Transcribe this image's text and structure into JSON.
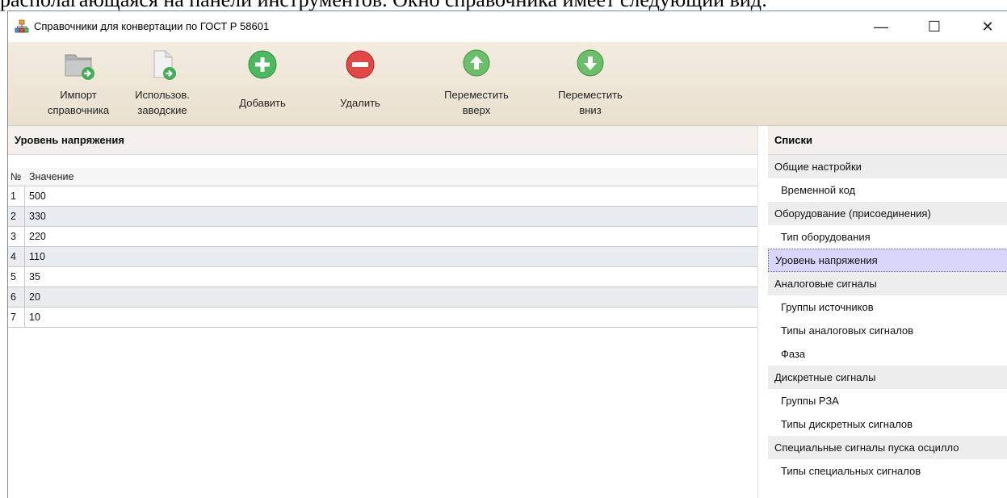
{
  "doc_text": "располагающаяся на панели инструментов. Окно справочника имеет следующий вид:",
  "window": {
    "title": "Справочники для конвертации по ГОСТ Р 58601",
    "minimize": "—",
    "maximize": "☐",
    "close": "✕"
  },
  "toolbar": {
    "import": {
      "line1": "Импорт",
      "line2": "справочника"
    },
    "use_factory": {
      "line1": "Использов.",
      "line2": "заводские"
    },
    "add": {
      "line1": "Добавить"
    },
    "delete": {
      "line1": "Удалить"
    },
    "move_up": {
      "line1": "Переместить",
      "line2": "вверх"
    },
    "move_down": {
      "line1": "Переместить",
      "line2": "вниз"
    }
  },
  "left_panel": {
    "title": "Уровень напряжения",
    "columns": {
      "no": "№",
      "value": "Значение"
    },
    "rows": [
      {
        "no": "1",
        "value": "500"
      },
      {
        "no": "2",
        "value": "330"
      },
      {
        "no": "3",
        "value": "220"
      },
      {
        "no": "4",
        "value": "110"
      },
      {
        "no": "5",
        "value": "35"
      },
      {
        "no": "6",
        "value": "20"
      },
      {
        "no": "7",
        "value": "10"
      }
    ]
  },
  "right_panel": {
    "title": "Списки",
    "items": [
      {
        "label": "Общие настройки",
        "type": "group"
      },
      {
        "label": "Временной код",
        "type": "child"
      },
      {
        "label": "Оборудование (присоединения)",
        "type": "group"
      },
      {
        "label": "Тип оборудования",
        "type": "child"
      },
      {
        "label": "Уровень напряжения",
        "type": "selected"
      },
      {
        "label": "Аналоговые сигналы",
        "type": "group"
      },
      {
        "label": "Группы источников",
        "type": "child"
      },
      {
        "label": "Типы аналоговых сигналов",
        "type": "child"
      },
      {
        "label": "Фаза",
        "type": "child"
      },
      {
        "label": "Дискретные сигналы",
        "type": "group"
      },
      {
        "label": "Группы РЗА",
        "type": "child"
      },
      {
        "label": "Типы дискретных сигналов",
        "type": "child"
      },
      {
        "label": "Специальные сигналы пуска осцилло",
        "type": "group"
      },
      {
        "label": "Типы специальных сигналов",
        "type": "child"
      }
    ]
  }
}
